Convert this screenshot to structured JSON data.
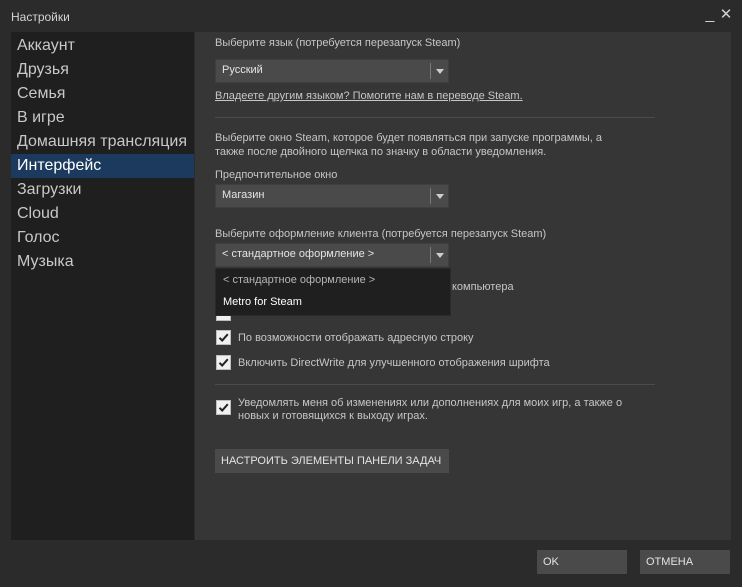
{
  "window": {
    "title": "Настройки",
    "minimize": "_",
    "close": "✕"
  },
  "sidebar": {
    "items": [
      {
        "label": "Аккаунт",
        "active": false
      },
      {
        "label": "Друзья",
        "active": false
      },
      {
        "label": "Семья",
        "active": false
      },
      {
        "label": "В игре",
        "active": false
      },
      {
        "label": "Домашняя трансляция",
        "active": false
      },
      {
        "label": "Интерфейс",
        "active": true
      },
      {
        "label": "Загрузки",
        "active": false
      },
      {
        "label": "Cloud",
        "active": false
      },
      {
        "label": "Голос",
        "active": false
      },
      {
        "label": "Музыка",
        "active": false
      }
    ]
  },
  "language": {
    "heading": "Выберите язык (потребуется перезапуск Steam)",
    "value": "Русский",
    "help_link": "Владеете другим языком? Помогите нам в переводе Steam."
  },
  "startup_window": {
    "description_line1": "Выберите окно Steam, которое будет появляться при запуске программы, а",
    "description_line2": "также после двойного щелчка по значку в области уведомления.",
    "label": "Предпочтительное окно",
    "value": "Магазин"
  },
  "skin": {
    "label": "Выберите оформление клиента (потребуется перезапуск Steam)",
    "value": "< стандартное оформление >",
    "options": [
      "< стандартное оформление >",
      "Metro for Steam"
    ]
  },
  "checkboxes": {
    "partial_text": "компьютера",
    "address_bar": "По возможности отображать адресную строку",
    "directwrite": "Включить DirectWrite для улучшенного отображения шрифта",
    "notify_line1": "Уведомлять меня об изменениях или дополнениях для моих игр, а также о",
    "notify_line2": "новых и готовящихся к выходу играх."
  },
  "buttons": {
    "taskbar": "НАСТРОИТЬ ЭЛЕМЕНТЫ ПАНЕЛИ ЗАДАЧ",
    "ok": "OK",
    "cancel": "ОТМЕНА"
  }
}
